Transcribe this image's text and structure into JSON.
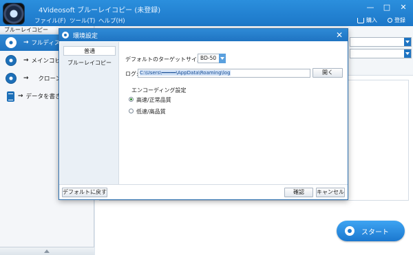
{
  "app": {
    "title": "4Videosoft ブルーレイコピー (未登録)",
    "menu": [
      "ファイル(F)",
      "ツール(T)",
      "ヘルプ(H)"
    ],
    "buy_label": "購入",
    "register_label": "登録",
    "controls": [
      "—",
      "□",
      "✕"
    ]
  },
  "sidebar": {
    "header": "ブルーレイコピー",
    "items": [
      {
        "label": "フルディスク",
        "arrow": "→"
      },
      {
        "label": "メインコピー",
        "arrow": "→"
      },
      {
        "label": "クローン",
        "arrow": "→"
      },
      {
        "label": "データを書き込む",
        "arrow": "→"
      }
    ]
  },
  "main": {
    "start_label": "スタート"
  },
  "dialog": {
    "title": "環境設定",
    "close": "✕",
    "tabs": [
      "普通",
      "ブルーレイコピー"
    ],
    "target_size_label": "デフォルトのターゲットサイズ:",
    "target_size_value": "BD-50",
    "log_label": "ログ:",
    "log_path": "C:\\Users\\━━━━━\\AppData\\Roaming\\log",
    "open_label": "開く",
    "encoding_label": "エンコーディング設定",
    "options": [
      "高速/正常品質",
      "低速/高品質"
    ],
    "selected_option": 0,
    "reset_label": "デフォルトに戻す",
    "ok_label": "確認",
    "cancel_label": "キャンセル"
  }
}
